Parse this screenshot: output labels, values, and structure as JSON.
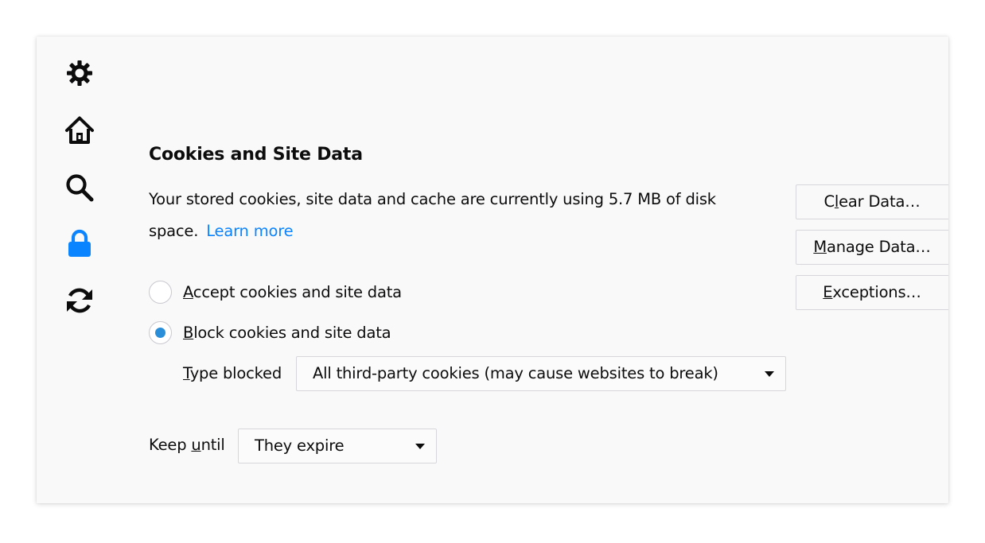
{
  "colors": {
    "accent": "#0a84ff",
    "link": "#0a84ff",
    "radio_dot": "#2a8fd8",
    "panel_bg": "#f9f9fa"
  },
  "sidebar": {
    "items": [
      {
        "icon": "gear-icon",
        "name": "general"
      },
      {
        "icon": "home-icon",
        "name": "home"
      },
      {
        "icon": "search-icon",
        "name": "search"
      },
      {
        "icon": "lock-icon",
        "name": "privacy",
        "selected": true
      },
      {
        "icon": "sync-icon",
        "name": "sync"
      }
    ]
  },
  "cookies": {
    "title": "Cookies and Site Data",
    "description": "Your stored cookies, site data and cache are currently using 5.7 MB of disk space.",
    "learn_more": "Learn more",
    "buttons": {
      "clear_data": {
        "before": "C",
        "key": "l",
        "after": "ear Data…"
      },
      "manage_data": {
        "before": "",
        "key": "M",
        "after": "anage Data…"
      },
      "exceptions": {
        "before": "",
        "key": "E",
        "after": "xceptions…"
      }
    },
    "radios": {
      "accept": {
        "key": "A",
        "rest": "ccept cookies and site data",
        "checked": false
      },
      "block": {
        "key": "B",
        "rest": "lock cookies and site data",
        "checked": true
      }
    },
    "type_blocked": {
      "label_key": "T",
      "label_rest": "ype blocked",
      "value": "All third-party cookies (may cause websites to break)"
    },
    "keep_until": {
      "label_before": "Keep ",
      "label_key": "u",
      "label_after": "ntil",
      "value": "They expire"
    }
  }
}
